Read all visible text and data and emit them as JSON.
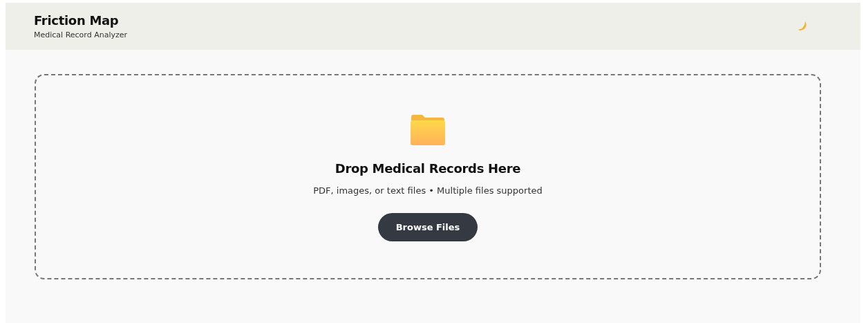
{
  "header": {
    "title": "Friction Map",
    "subtitle": "Medical Record Analyzer"
  },
  "dropzone": {
    "title": "Drop Medical Records Here",
    "hint": "PDF, images, or text files • Multiple files supported",
    "button": "Browse Files"
  }
}
